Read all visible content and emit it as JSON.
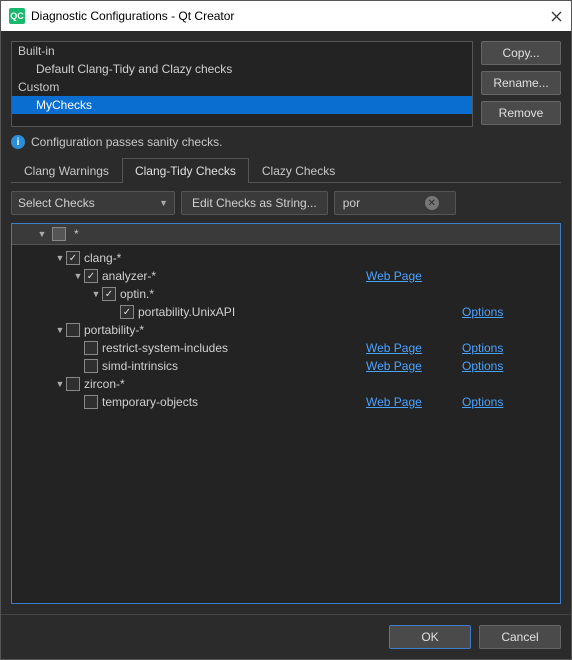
{
  "window": {
    "title": "Diagnostic Configurations - Qt Creator",
    "logo_text": "QC"
  },
  "configs": {
    "builtin_label": "Built-in",
    "builtin_items": [
      "Default Clang-Tidy and Clazy checks"
    ],
    "custom_label": "Custom",
    "custom_items": [
      "MyChecks"
    ],
    "selected": "MyChecks"
  },
  "side_buttons": {
    "copy": "Copy...",
    "rename": "Rename...",
    "remove": "Remove"
  },
  "sanity_text": "Configuration passes sanity checks.",
  "tabs": {
    "clang_warnings": "Clang Warnings",
    "clang_tidy": "Clang-Tidy Checks",
    "clazy": "Clazy Checks",
    "active": "clang_tidy"
  },
  "toolbar": {
    "select_checks": "Select Checks",
    "edit_as_string": "Edit Checks as String...",
    "filter_value": "por"
  },
  "tree_header": "*",
  "links": {
    "web_page": "Web Page",
    "options": "Options"
  },
  "tree": [
    {
      "indent": 1,
      "twisty": "down",
      "checked": true,
      "label": "clang-*"
    },
    {
      "indent": 2,
      "twisty": "down",
      "checked": true,
      "label": "analyzer-*",
      "webpage": true
    },
    {
      "indent": 3,
      "twisty": "down",
      "checked": true,
      "label": "optin.*"
    },
    {
      "indent": 4,
      "twisty": "",
      "checked": true,
      "label": "portability.UnixAPI",
      "options": true
    },
    {
      "indent": 1,
      "twisty": "down",
      "checked": false,
      "label": "portability-*"
    },
    {
      "indent": 2,
      "twisty": "",
      "checked": false,
      "label": "restrict-system-includes",
      "webpage": true,
      "options": true
    },
    {
      "indent": 2,
      "twisty": "",
      "checked": false,
      "label": "simd-intrinsics",
      "webpage": true,
      "options": true
    },
    {
      "indent": 1,
      "twisty": "down",
      "checked": false,
      "label": "zircon-*"
    },
    {
      "indent": 2,
      "twisty": "",
      "checked": false,
      "label": "temporary-objects",
      "webpage": true,
      "options": true
    }
  ],
  "footer": {
    "ok": "OK",
    "cancel": "Cancel"
  }
}
